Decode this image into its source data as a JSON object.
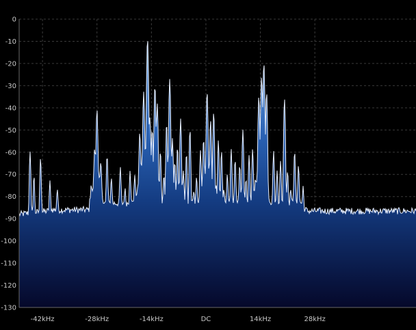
{
  "chart_data": {
    "type": "area",
    "title": "",
    "xlabel": "",
    "ylabel": "",
    "x_unit": "kHz",
    "x_range_khz": [
      -48,
      54
    ],
    "ylim": [
      -130,
      0
    ],
    "y_ticks": [
      0,
      -10,
      -20,
      -30,
      -40,
      -50,
      -60,
      -70,
      -80,
      -90,
      -100,
      -110,
      -120,
      -130
    ],
    "x_ticks": [
      {
        "value": -42,
        "label": "-42kHz"
      },
      {
        "value": -28,
        "label": "-28kHz"
      },
      {
        "value": -14,
        "label": "-14kHz"
      },
      {
        "value": 0,
        "label": "DC"
      },
      {
        "value": 14,
        "label": "14kHz"
      },
      {
        "value": 28,
        "label": "28kHz"
      }
    ],
    "grid": true,
    "noise_floor_db": -86,
    "peaks": [
      {
        "x": -45.2,
        "y": -60
      },
      {
        "x": -44.2,
        "y": -72
      },
      {
        "x": -42.5,
        "y": -63
      },
      {
        "x": -40.1,
        "y": -75
      },
      {
        "x": -38.2,
        "y": -80
      },
      {
        "x": -29.5,
        "y": -80
      },
      {
        "x": -28.6,
        "y": -60
      },
      {
        "x": -28.0,
        "y": -41
      },
      {
        "x": -27.0,
        "y": -67
      },
      {
        "x": -25.4,
        "y": -62
      },
      {
        "x": -24.3,
        "y": -74
      },
      {
        "x": -22.0,
        "y": -68
      },
      {
        "x": -20.8,
        "y": -82
      },
      {
        "x": -19.5,
        "y": -70
      },
      {
        "x": -18.3,
        "y": -73
      },
      {
        "x": -17.0,
        "y": -52
      },
      {
        "x": -16.0,
        "y": -33
      },
      {
        "x": -15.0,
        "y": -9
      },
      {
        "x": -14.4,
        "y": -45
      },
      {
        "x": -13.8,
        "y": -50
      },
      {
        "x": -13.1,
        "y": -30
      },
      {
        "x": -12.5,
        "y": -38
      },
      {
        "x": -11.7,
        "y": -60
      },
      {
        "x": -10.8,
        "y": -72
      },
      {
        "x": -10.1,
        "y": -47
      },
      {
        "x": -9.3,
        "y": -27
      },
      {
        "x": -8.6,
        "y": -54
      },
      {
        "x": -8.0,
        "y": -65
      },
      {
        "x": -7.3,
        "y": -58
      },
      {
        "x": -6.5,
        "y": -45
      },
      {
        "x": -5.8,
        "y": -70
      },
      {
        "x": -5.0,
        "y": -61
      },
      {
        "x": -4.1,
        "y": -50
      },
      {
        "x": -3.1,
        "y": -85
      },
      {
        "x": -2.4,
        "y": -74
      },
      {
        "x": -1.4,
        "y": -60
      },
      {
        "x": -0.6,
        "y": -55
      },
      {
        "x": 0.3,
        "y": -33
      },
      {
        "x": 1.2,
        "y": -46
      },
      {
        "x": 2.0,
        "y": -42
      },
      {
        "x": 2.6,
        "y": -80
      },
      {
        "x": 3.2,
        "y": -55
      },
      {
        "x": 4.0,
        "y": -60
      },
      {
        "x": 4.6,
        "y": -83
      },
      {
        "x": 5.5,
        "y": -72
      },
      {
        "x": 6.5,
        "y": -59
      },
      {
        "x": 7.5,
        "y": -64
      },
      {
        "x": 8.7,
        "y": -67
      },
      {
        "x": 9.5,
        "y": -50
      },
      {
        "x": 10.3,
        "y": -75
      },
      {
        "x": 11.1,
        "y": -62
      },
      {
        "x": 12.0,
        "y": -59
      },
      {
        "x": 12.7,
        "y": -80
      },
      {
        "x": 13.6,
        "y": -35
      },
      {
        "x": 14.3,
        "y": -26
      },
      {
        "x": 14.9,
        "y": -20
      },
      {
        "x": 15.6,
        "y": -33
      },
      {
        "x": 17.4,
        "y": -60
      },
      {
        "x": 18.3,
        "y": -70
      },
      {
        "x": 19.2,
        "y": -65
      },
      {
        "x": 20.2,
        "y": -36
      },
      {
        "x": 21.0,
        "y": -70
      },
      {
        "x": 21.8,
        "y": -82
      },
      {
        "x": 22.8,
        "y": -60
      },
      {
        "x": 23.8,
        "y": -67
      },
      {
        "x": 25.0,
        "y": -80
      }
    ]
  }
}
